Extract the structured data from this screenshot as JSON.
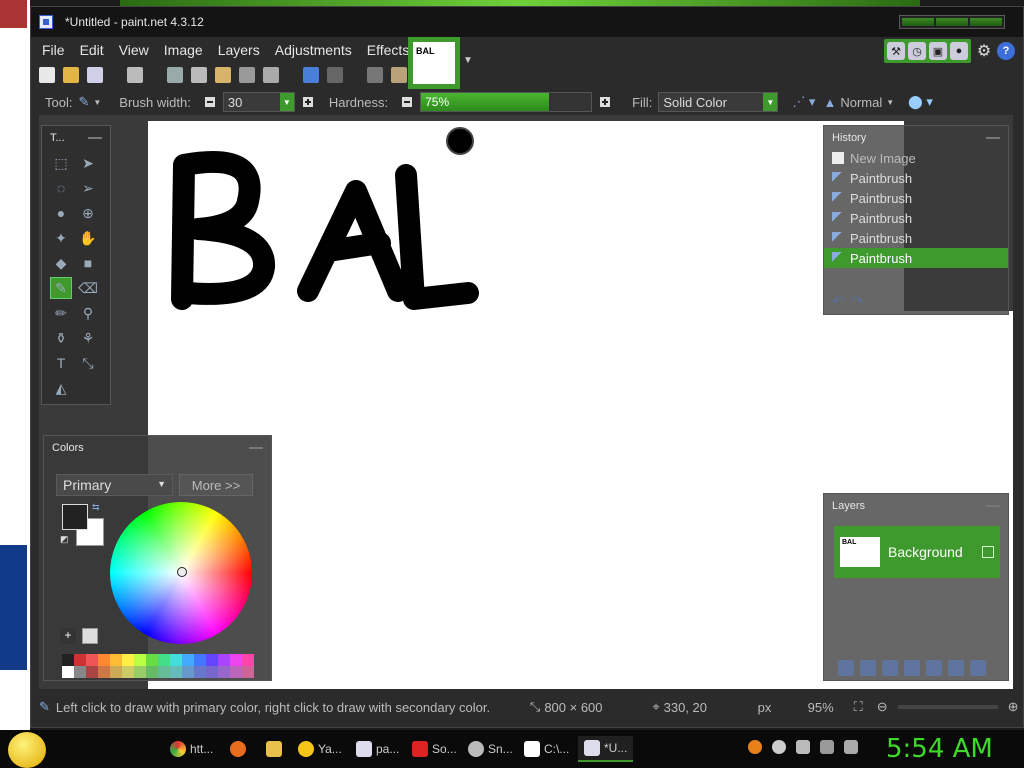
{
  "window": {
    "title": "*Untitled - paint.net 4.3.12"
  },
  "menu": [
    "File",
    "Edit",
    "View",
    "Image",
    "Layers",
    "Adjustments",
    "Effects"
  ],
  "image_tab": {
    "thumb_text": "BAL"
  },
  "toolbar": {
    "tool_label": "Tool:",
    "brush_width_label": "Brush width:",
    "brush_width_value": "30",
    "hardness_label": "Hardness:",
    "hardness_value": "75%",
    "hardness_fraction": 0.75,
    "fill_label": "Fill:",
    "fill_value": "Solid Color",
    "blend_mode": "Normal"
  },
  "panels": {
    "tools_title": "T...",
    "colors": {
      "title": "Colors",
      "mode": "Primary",
      "more_button": "More >>",
      "primary_color": "#222222",
      "secondary_color": "#ffffff"
    },
    "history": {
      "title": "History",
      "items": [
        "New Image",
        "Paintbrush",
        "Paintbrush",
        "Paintbrush",
        "Paintbrush",
        "Paintbrush"
      ],
      "active_index": 5
    },
    "layers": {
      "title": "Layers",
      "layer_name": "Background",
      "thumb_text": "BAL"
    }
  },
  "canvas": {
    "drawn_text": "BAL"
  },
  "status": {
    "hint": "Left click to draw with primary color, right click to draw with secondary color.",
    "image_size": "800 × 600",
    "cursor": "330, 20",
    "units": "px",
    "zoom": "95%"
  },
  "taskbar": {
    "items": [
      "htt...",
      "Ya...",
      "pa...",
      "So...",
      "Sn...",
      "C:\\...",
      "*U..."
    ],
    "clock": "5:54 AM"
  },
  "colors": {
    "accent": "#3e9a2c",
    "clock": "#3dda2a"
  }
}
